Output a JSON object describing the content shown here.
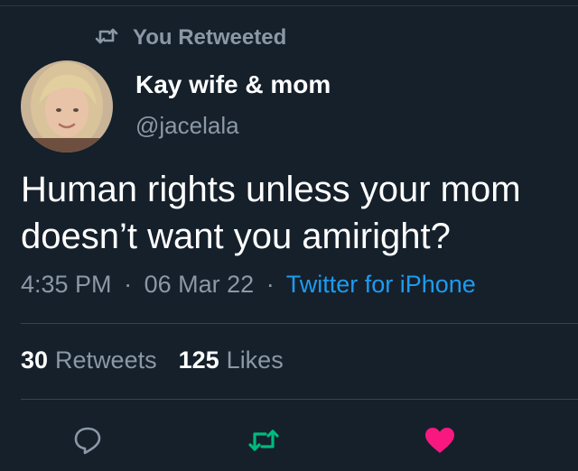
{
  "context": {
    "retweet_label": "You Retweeted"
  },
  "author": {
    "display_name": "Kay wife & mom",
    "handle": "@jacelala"
  },
  "tweet": {
    "text": "Human rights unless your mom doesn’t want you amiright?",
    "time": "4:35 PM",
    "date": "06 Mar 22",
    "separator": "·",
    "source": "Twitter for iPhone"
  },
  "stats": {
    "retweets_count": "30",
    "retweets_label": "Retweets",
    "likes_count": "125",
    "likes_label": "Likes"
  },
  "actions": [
    {
      "name": "reply",
      "icon": "reply-icon"
    },
    {
      "name": "retweet",
      "icon": "retweet-icon",
      "active": true
    },
    {
      "name": "like",
      "icon": "heart-icon",
      "active": true
    }
  ],
  "colors": {
    "background": "#15202b",
    "muted": "#8b98a5",
    "link": "#1d9bf0",
    "retweet_active": "#00ba7c",
    "like_active": "#f91880"
  }
}
